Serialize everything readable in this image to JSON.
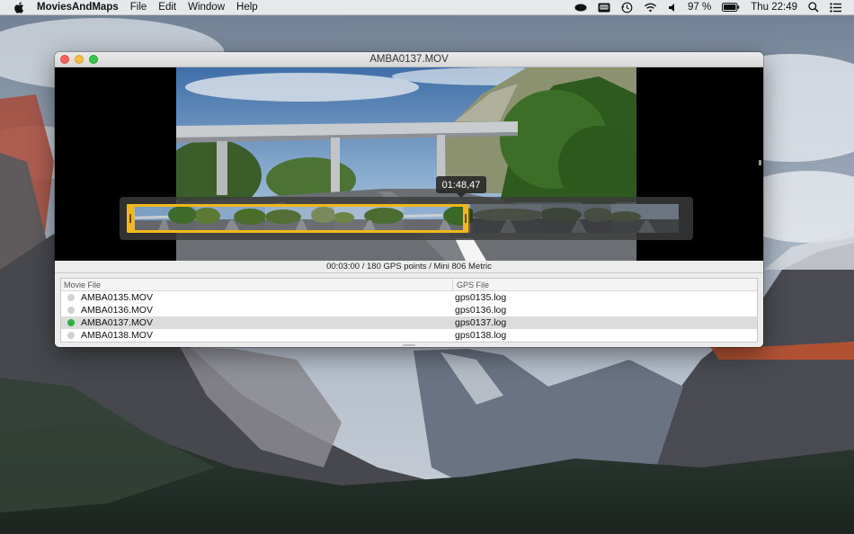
{
  "menubar": {
    "app_name": "MoviesAndMaps",
    "items": [
      "File",
      "Edit",
      "Window",
      "Help"
    ],
    "battery_percent": "97 %",
    "clock": "Thu 22:49",
    "icons": [
      "apple-icon",
      "cloud-icon",
      "display-icon",
      "time-machine-icon",
      "wifi-icon",
      "volume-icon",
      "battery-icon",
      "spotlight-icon",
      "notification-center-icon"
    ]
  },
  "window": {
    "title": "AMBA0137.MOV",
    "timecode": "01:48,47",
    "status": "00:03:00 / 180 GPS points / Mini 806 Metric",
    "table": {
      "headers": [
        "Movie File",
        "GPS File"
      ],
      "rows": [
        {
          "movie": "AMBA0135.MOV",
          "gps": "gps0135.log",
          "active": false,
          "selected": false
        },
        {
          "movie": "AMBA0136.MOV",
          "gps": "gps0136.log",
          "active": false,
          "selected": false
        },
        {
          "movie": "AMBA0137.MOV",
          "gps": "gps0137.log",
          "active": true,
          "selected": true
        },
        {
          "movie": "AMBA0138.MOV",
          "gps": "gps0138.log",
          "active": false,
          "selected": false
        }
      ]
    }
  },
  "colors": {
    "selection_accent": "#f5b719",
    "active_dot": "#2bb34a",
    "close": "#fc605c",
    "minimize": "#fdbc40",
    "maximize": "#34c84a"
  }
}
